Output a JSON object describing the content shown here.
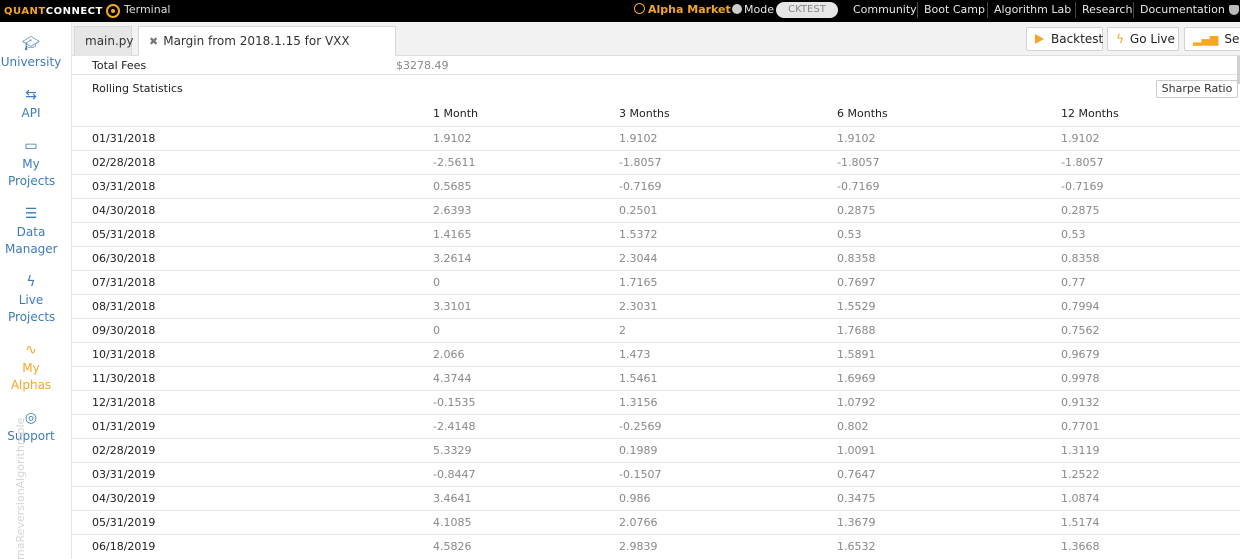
{
  "topbar": {
    "logo_part1": "QUANT",
    "logo_part2": "CONNECT",
    "terminal": "Terminal",
    "alpha_market": "Alpha Market",
    "mode_label": "Mode",
    "mode_value": "CKTEST",
    "nav": [
      "Community",
      "Boot Camp",
      "Algorithm Lab",
      "Research",
      "Documentation"
    ]
  },
  "sidebar": {
    "items": [
      {
        "label": "University",
        "icon": "graduation-cap-icon"
      },
      {
        "label": "API",
        "icon": "usb-icon"
      },
      {
        "label": "My Projects",
        "icon": "folder-open-icon"
      },
      {
        "label": "Data Manager",
        "icon": "database-icon"
      },
      {
        "label": "Live Projects",
        "icon": "lightning-icon"
      },
      {
        "label": "My Alphas",
        "icon": "alpha-wave-icon"
      },
      {
        "label": "Support",
        "icon": "life-ring-icon"
      }
    ],
    "vertical_text": "maReversionAlgorithmple"
  },
  "tabs": {
    "main": "main.py",
    "active": "Margin from 2018.1.15 for VXX",
    "backtest": "Backtest",
    "go_live": "Go Live",
    "see": "See R"
  },
  "stats": {
    "total_fees_label": "Total Fees",
    "total_fees_value": "$3278.49",
    "rolling_title": "Rolling Statistics",
    "sharpe_button": "Sharpe Ratio",
    "columns": [
      "",
      "1 Month",
      "3 Months",
      "6 Months",
      "12 Months"
    ],
    "rows": [
      [
        "01/31/2018",
        "1.9102",
        "1.9102",
        "1.9102",
        "1.9102"
      ],
      [
        "02/28/2018",
        "-2.5611",
        "-1.8057",
        "-1.8057",
        "-1.8057"
      ],
      [
        "03/31/2018",
        "0.5685",
        "-0.7169",
        "-0.7169",
        "-0.7169"
      ],
      [
        "04/30/2018",
        "2.6393",
        "0.2501",
        "0.2875",
        "0.2875"
      ],
      [
        "05/31/2018",
        "1.4165",
        "1.5372",
        "0.53",
        "0.53"
      ],
      [
        "06/30/2018",
        "3.2614",
        "2.3044",
        "0.8358",
        "0.8358"
      ],
      [
        "07/31/2018",
        "0",
        "1.7165",
        "0.7697",
        "0.77"
      ],
      [
        "08/31/2018",
        "3.3101",
        "2.3031",
        "1.5529",
        "0.7994"
      ],
      [
        "09/30/2018",
        "0",
        "2",
        "1.7688",
        "0.7562"
      ],
      [
        "10/31/2018",
        "2.066",
        "1.473",
        "1.5891",
        "0.9679"
      ],
      [
        "11/30/2018",
        "4.3744",
        "1.5461",
        "1.6969",
        "0.9978"
      ],
      [
        "12/31/2018",
        "-0.1535",
        "1.3156",
        "1.0792",
        "0.9132"
      ],
      [
        "01/31/2019",
        "-2.4148",
        "-0.2569",
        "0.802",
        "0.7701"
      ],
      [
        "02/28/2019",
        "5.3329",
        "0.1989",
        "1.0091",
        "1.3119"
      ],
      [
        "03/31/2019",
        "-0.8447",
        "-0.1507",
        "0.7647",
        "1.2522"
      ],
      [
        "04/30/2019",
        "3.4641",
        "0.986",
        "0.3475",
        "1.0874"
      ],
      [
        "05/31/2019",
        "4.1085",
        "2.0766",
        "1.3679",
        "1.5174"
      ],
      [
        "06/18/2019",
        "4.5826",
        "2.9839",
        "1.6532",
        "1.3668"
      ]
    ]
  },
  "colors": {
    "accent": "#f5a623",
    "link": "#3b7bbf",
    "topbar": "#000000"
  }
}
